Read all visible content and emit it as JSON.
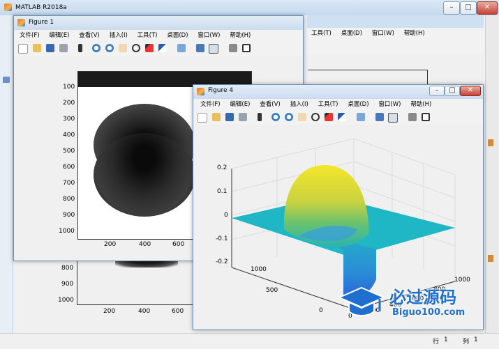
{
  "app": {
    "title": "MATLAB R2018a"
  },
  "statusbar": {
    "row_label": "行",
    "row_value": "1",
    "col_label": "列",
    "col_value": "1"
  },
  "figure1": {
    "title": "Figure 1",
    "menu": [
      "文件(F)",
      "编辑(E)",
      "查看(V)",
      "插入(I)",
      "工具(T)",
      "桌面(D)",
      "窗口(W)",
      "帮助(H)"
    ],
    "yticks": [
      "100",
      "200",
      "300",
      "400",
      "500",
      "600",
      "700",
      "800",
      "900",
      "1000"
    ],
    "xticks": [
      "200",
      "400",
      "600"
    ]
  },
  "figure4": {
    "title": "Figure 4",
    "menu": [
      "文件(F)",
      "编辑(E)",
      "查看(V)",
      "插入(I)",
      "工具(T)",
      "桌面(D)",
      "窗口(W)",
      "帮助(H)"
    ],
    "zticks": [
      "0.2",
      "0.1",
      "0",
      "-0.1",
      "-0.2"
    ],
    "yticks": [
      "1000",
      "500",
      "0"
    ],
    "xticks": [
      "0",
      "200",
      "400",
      "600",
      "800",
      "1000"
    ]
  },
  "background_fig": {
    "menu": [
      "工具(T)",
      "桌面(D)",
      "窗口(W)",
      "帮助(H)"
    ],
    "yticks": [
      "800",
      "900",
      "1000"
    ],
    "xticks": [
      "200",
      "400",
      "600"
    ]
  },
  "watermark": {
    "text_cn": "必过源码",
    "text_en": "Biguo100.com"
  }
}
